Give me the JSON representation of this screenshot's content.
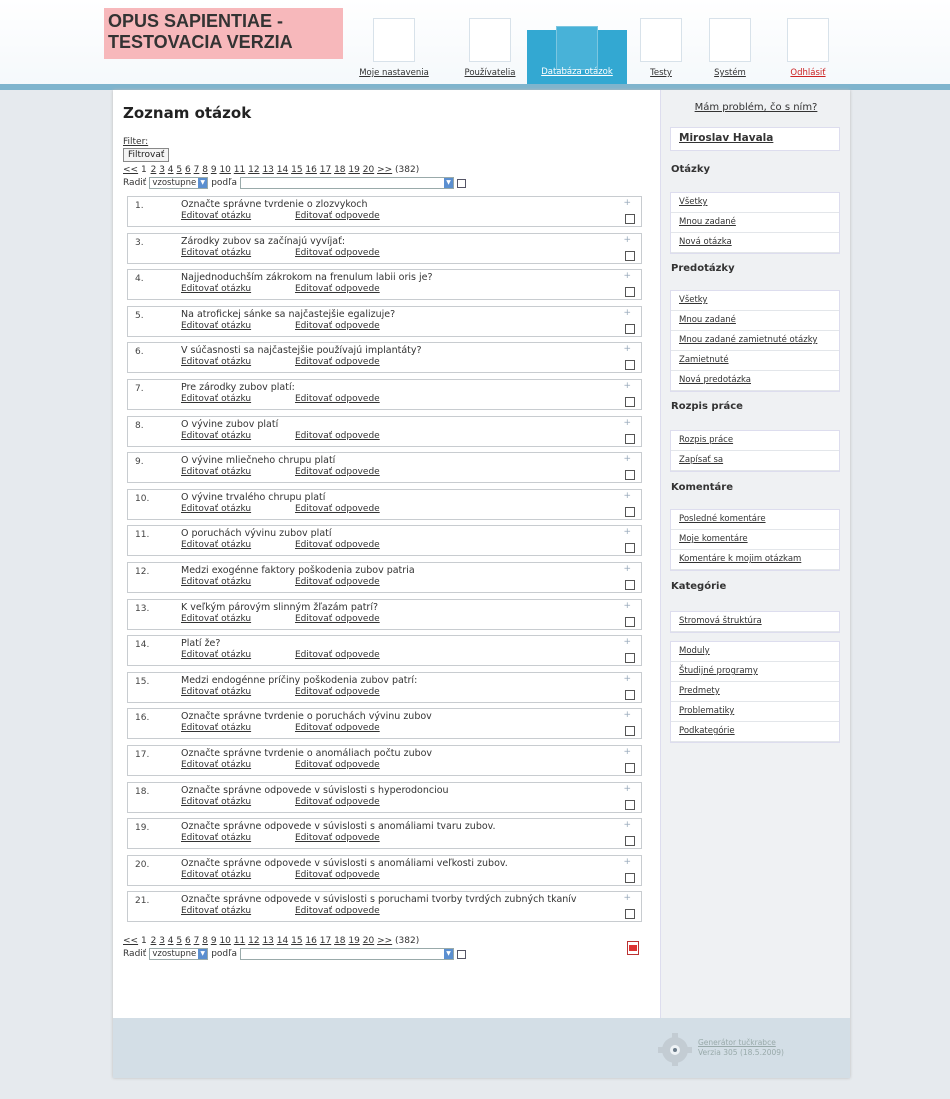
{
  "app": {
    "title_line1": "OPUS SAPIENTIAE -",
    "title_line2": "TESTOVACIA VERZIA"
  },
  "nav": [
    {
      "label": "Moje nastavenia",
      "active": false,
      "color": "#333333"
    },
    {
      "label": "Používatelia",
      "active": false,
      "color": "#333333"
    },
    {
      "label": "Databáza otázok",
      "active": true,
      "color": "#ffffff"
    },
    {
      "label": "Testy",
      "active": false,
      "color": "#333333"
    },
    {
      "label": "Systém",
      "active": false,
      "color": "#333333"
    },
    {
      "label": "Odhlásiť",
      "active": false,
      "color": "#cc2222"
    }
  ],
  "main": {
    "title": "Zoznam otázok",
    "filter_label": "Filter:",
    "filter_button": "Filtrovať",
    "pager": {
      "prev": "<<",
      "current": "1",
      "pages": [
        "2",
        "3",
        "4",
        "5",
        "6",
        "7",
        "8",
        "9",
        "10",
        "11",
        "12",
        "13",
        "14",
        "15",
        "16",
        "17",
        "18",
        "19",
        "20"
      ],
      "next": ">>",
      "total": "(382)"
    },
    "sort": {
      "label": "Radiť",
      "order_value": "vzostupne",
      "by_label": "podľa",
      "by_value": ""
    },
    "edit_question_label": "Editovať otázku",
    "edit_answers_label": "Editovať odpovede",
    "plus_icon": "+",
    "questions": [
      {
        "num": "1.",
        "text": "Označte správne tvrdenie o zlozvykoch"
      },
      {
        "num": "3.",
        "text": "Zárodky zubov sa začínajú vyvíjať:"
      },
      {
        "num": "4.",
        "text": "Najjednoduchším zákrokom na frenulum labii oris je?"
      },
      {
        "num": "5.",
        "text": "Na atrofickej sánke sa najčastejšie egalizuje?"
      },
      {
        "num": "6.",
        "text": "V súčasnosti sa najčastejšie používajú implantáty?"
      },
      {
        "num": "7.",
        "text": "Pre zárodky zubov platí:"
      },
      {
        "num": "8.",
        "text": "O vývine zubov platí"
      },
      {
        "num": "9.",
        "text": "O vývine mliečneho chrupu platí"
      },
      {
        "num": "10.",
        "text": "O vývine trvalého chrupu platí"
      },
      {
        "num": "11.",
        "text": "O poruchách vývinu zubov platí"
      },
      {
        "num": "12.",
        "text": "Medzi exogénne faktory poškodenia zubov patria"
      },
      {
        "num": "13.",
        "text": "K veľkým párovým slinným žľazám patrí?"
      },
      {
        "num": "14.",
        "text": "Platí že?"
      },
      {
        "num": "15.",
        "text": "Medzi endogénne príčiny poškodenia zubov patrí:"
      },
      {
        "num": "16.",
        "text": "Označte správne tvrdenie o poruchách vývinu zubov"
      },
      {
        "num": "17.",
        "text": "Označte správne tvrdenie o anomáliach počtu zubov"
      },
      {
        "num": "18.",
        "text": "Označte správne odpovede v súvislosti s hyperodonciou"
      },
      {
        "num": "19.",
        "text": "Označte správne odpovede v súvislosti s anomáliami tvaru zubov."
      },
      {
        "num": "20.",
        "text": "Označte správne odpovede v súvislosti s anomáliami veľkosti zubov."
      },
      {
        "num": "21.",
        "text": "Označte správne odpovede v súvislosti s poruchami tvorby tvrdých zubných tkanív"
      }
    ]
  },
  "sidebar": {
    "help_link": "Mám problém, čo s ním?",
    "user": "Miroslav Havala",
    "sections": [
      {
        "title": "Otázky",
        "items": [
          "Všetky",
          "Mnou zadané",
          "Nová otázka"
        ]
      },
      {
        "title": "Predotázky",
        "items": [
          "Všetky",
          "Mnou zadané",
          "Mnou zadané zamietnuté otázky",
          "Zamietnuté",
          "Nová predotázka"
        ]
      },
      {
        "title": "Rozpis práce",
        "items": [
          "Rozpis práce",
          "Zapísať sa"
        ]
      },
      {
        "title": "Komentáre",
        "items": [
          "Posledné komentáre",
          "Moje komentáre",
          "Komentáre k mojim otázkam"
        ]
      },
      {
        "title": "Kategórie",
        "items": [
          "Stromová štruktúra"
        ]
      },
      {
        "title": "",
        "items": [
          "Moduly",
          "Študijné programy",
          "Predmety",
          "Problematiky",
          "Podkategórie"
        ]
      }
    ]
  },
  "footer": {
    "line1": "Generátor tučkrabce",
    "line2": "Verzia 305 (18.5.2009)"
  }
}
